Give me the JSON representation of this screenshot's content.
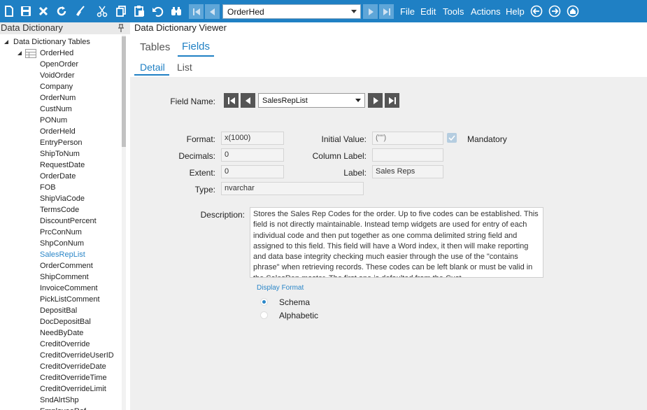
{
  "toolbar": {
    "table_select_value": "OrderHed",
    "menu": [
      "File",
      "Edit",
      "Tools",
      "Actions",
      "Help"
    ]
  },
  "left_panel": {
    "title": "Data Dictionary",
    "root": "Data Dictionary Tables",
    "table": "OrderHed",
    "fields": [
      "OpenOrder",
      "VoidOrder",
      "Company",
      "OrderNum",
      "CustNum",
      "PONum",
      "OrderHeld",
      "EntryPerson",
      "ShipToNum",
      "RequestDate",
      "OrderDate",
      "FOB",
      "ShipViaCode",
      "TermsCode",
      "DiscountPercent",
      "PrcConNum",
      "ShpConNum",
      "SalesRepList",
      "OrderComment",
      "ShipComment",
      "InvoiceComment",
      "PickListComment",
      "DepositBal",
      "DocDepositBal",
      "NeedByDate",
      "CreditOverride",
      "CreditOverrideUserID",
      "CreditOverrideDate",
      "CreditOverrideTime",
      "CreditOverrideLimit",
      "SndAlrtShp",
      "EmployeeRef"
    ],
    "selected": "SalesRepList"
  },
  "main": {
    "title": "Data Dictionary Viewer",
    "tabs": [
      "Tables",
      "Fields"
    ],
    "active_tab": "Fields",
    "subtabs": [
      "Detail",
      "List"
    ],
    "active_subtab": "Detail"
  },
  "form": {
    "field_name_label": "Field Name:",
    "field_name_value": "SalesRepList",
    "format_label": "Format:",
    "format_value": "x(1000)",
    "decimals_label": "Decimals:",
    "decimals_value": "0",
    "extent_label": "Extent:",
    "extent_value": "0",
    "type_label": "Type:",
    "type_value": "nvarchar",
    "initial_value_label": "Initial Value:",
    "initial_value": "(\"\")",
    "mandatory_label": "Mandatory",
    "mandatory_checked": true,
    "column_label_label": "Column Label:",
    "column_label_value": "",
    "label_label": "Label:",
    "label_value": "Sales Reps",
    "description_label": "Description:",
    "description": "Stores the Sales Rep Codes for the order. Up to five codes can be  established. This field is not directly maintainable. Instead temp widgets are used for entry of each individual code and then put together as one comma delimited string field and assigned to this field.  This field will have a Word index, it then will make reporting and data base integrity checking much easier through the use of the \"contains phrase\" when retrieving records. These codes can be left blank or must be valid in the SalesRep master. The first one is defaulted from the Cust",
    "display_format_label": "Display Format",
    "display_format_options": [
      "Schema",
      "Alphabetic"
    ],
    "display_format_selected": "Schema"
  },
  "colors": {
    "toolbar": "#1f80c4",
    "accent": "#1f80c4",
    "selected_tree_item": "#2a86c8",
    "panel_background": "#efefef"
  }
}
